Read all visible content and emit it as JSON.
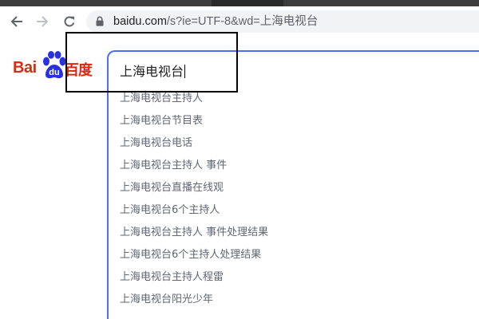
{
  "browser": {
    "url_host": "baidu.com",
    "url_rest": "/s?ie=UTF-8&wd=上海电视台"
  },
  "logo": {
    "text_latin": "Bai",
    "text_du": "du",
    "text_cn": "百度",
    "brand_color": "#de2910",
    "paw_color": "#2932e1"
  },
  "search": {
    "query": "上海电视台",
    "accent_color": "#4e6ef2"
  },
  "suggestions": [
    "上海电视台主持人",
    "上海电视台节目表",
    "上海电视台电话",
    "上海电视台主持人 事件",
    "上海电视台直播在线观",
    "上海电视台6个主持人",
    "上海电视台主持人 事件处理结果",
    "上海电视台6个主持人处理结果",
    "上海电视台主持人程雷",
    "上海电视台阳光少年"
  ]
}
